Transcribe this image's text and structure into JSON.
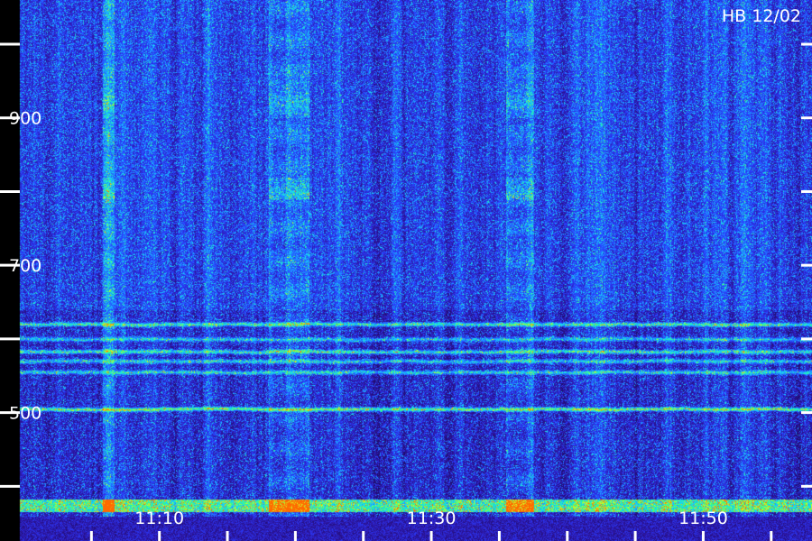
{
  "chart_data": {
    "type": "heatmap",
    "title": "HB 12/02",
    "xlabel": "",
    "ylabel": "",
    "y_tick_labels": [
      "900",
      "700",
      "500"
    ],
    "y_ticks": [
      1000,
      900,
      800,
      700,
      600,
      500,
      400
    ],
    "ylim": [
      360,
      1060
    ],
    "x_tick_labels": [
      "11:10",
      "11:30",
      "11:50"
    ],
    "x_labeled_times_min": [
      10,
      30,
      50
    ],
    "x_ticks_min": [
      5,
      10,
      15,
      20,
      25,
      30,
      35,
      40,
      45,
      50,
      55
    ],
    "xlim_min": [
      0,
      58
    ],
    "harmonic_lines": [
      {
        "freq": 620,
        "strength": 0.8
      },
      {
        "freq": 600,
        "strength": 0.55
      },
      {
        "freq": 583,
        "strength": 0.75
      },
      {
        "freq": 570,
        "strength": 0.6
      },
      {
        "freq": 555,
        "strength": 0.65
      },
      {
        "freq": 505,
        "strength": 1.0
      }
    ],
    "bright_bursts_min": [
      [
        5.8,
        6.7
      ],
      [
        18.0,
        21.0
      ],
      [
        35.5,
        37.5
      ]
    ],
    "baseline_band_freq": [
      368,
      378
    ],
    "colormap": [
      "#1c0a60",
      "#2e17a8",
      "#2a3cff",
      "#1f86ff",
      "#18d6ff",
      "#2aff8a",
      "#d8ff20",
      "#ff6a00"
    ],
    "grid": false,
    "legend": "none"
  }
}
